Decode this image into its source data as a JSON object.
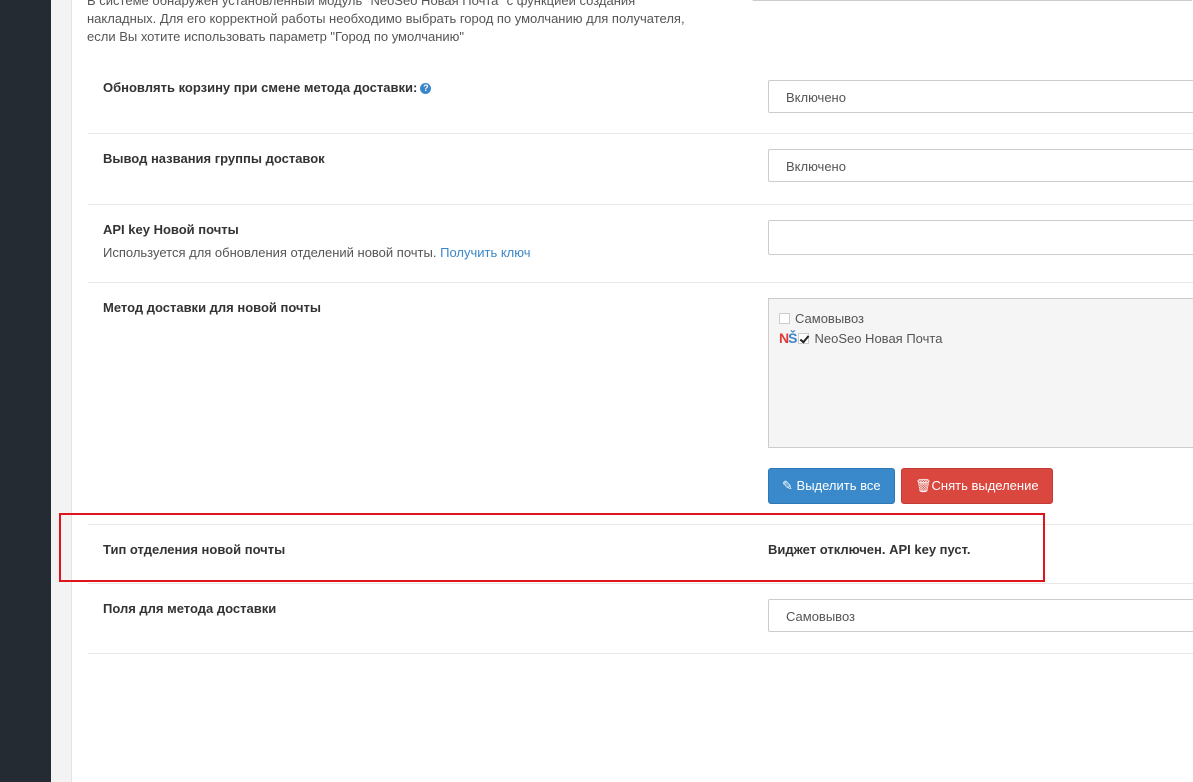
{
  "top_help": {
    "line1": "В системе обнаружен установленный модуль \"NeoSeo Новая Почта\" с функцией создания",
    "line2": "накладных. Для его корректной работы необходимо выбрать город по умолчанию для получателя,",
    "line3": "если Вы хотите использовать параметр \"Город по умолчанию\""
  },
  "update_cart": {
    "label": "Обновлять корзину при смене метода доставки:",
    "value": "Включено",
    "icon": "question-icon"
  },
  "group_name": {
    "label": "Вывод названия группы доставок",
    "value": "Включено"
  },
  "api_key": {
    "label": "API key Новой почты",
    "help": "Используется для обновления отделений новой почты.",
    "link": "Получить ключ",
    "value": ""
  },
  "delivery_method": {
    "label": "Метод доставки для новой почты",
    "options": [
      {
        "label": "Самовывоз",
        "checked": false
      },
      {
        "label": "NeoSeo Новая Почта",
        "checked": true,
        "logo": "NS"
      }
    ],
    "select_all_label": "Выделить все",
    "deselect_label": "Снять выделение"
  },
  "branch_type": {
    "label": "Тип отделения новой почты",
    "status": "Виджет отключен. API key пуст."
  },
  "fields": {
    "label": "Поля для метода доставки",
    "value": "Самовывоз"
  },
  "colors": {
    "primary": "#3a8acb",
    "danger": "#d9473f",
    "highlight": "#e0141c",
    "link": "#3b86c8"
  }
}
